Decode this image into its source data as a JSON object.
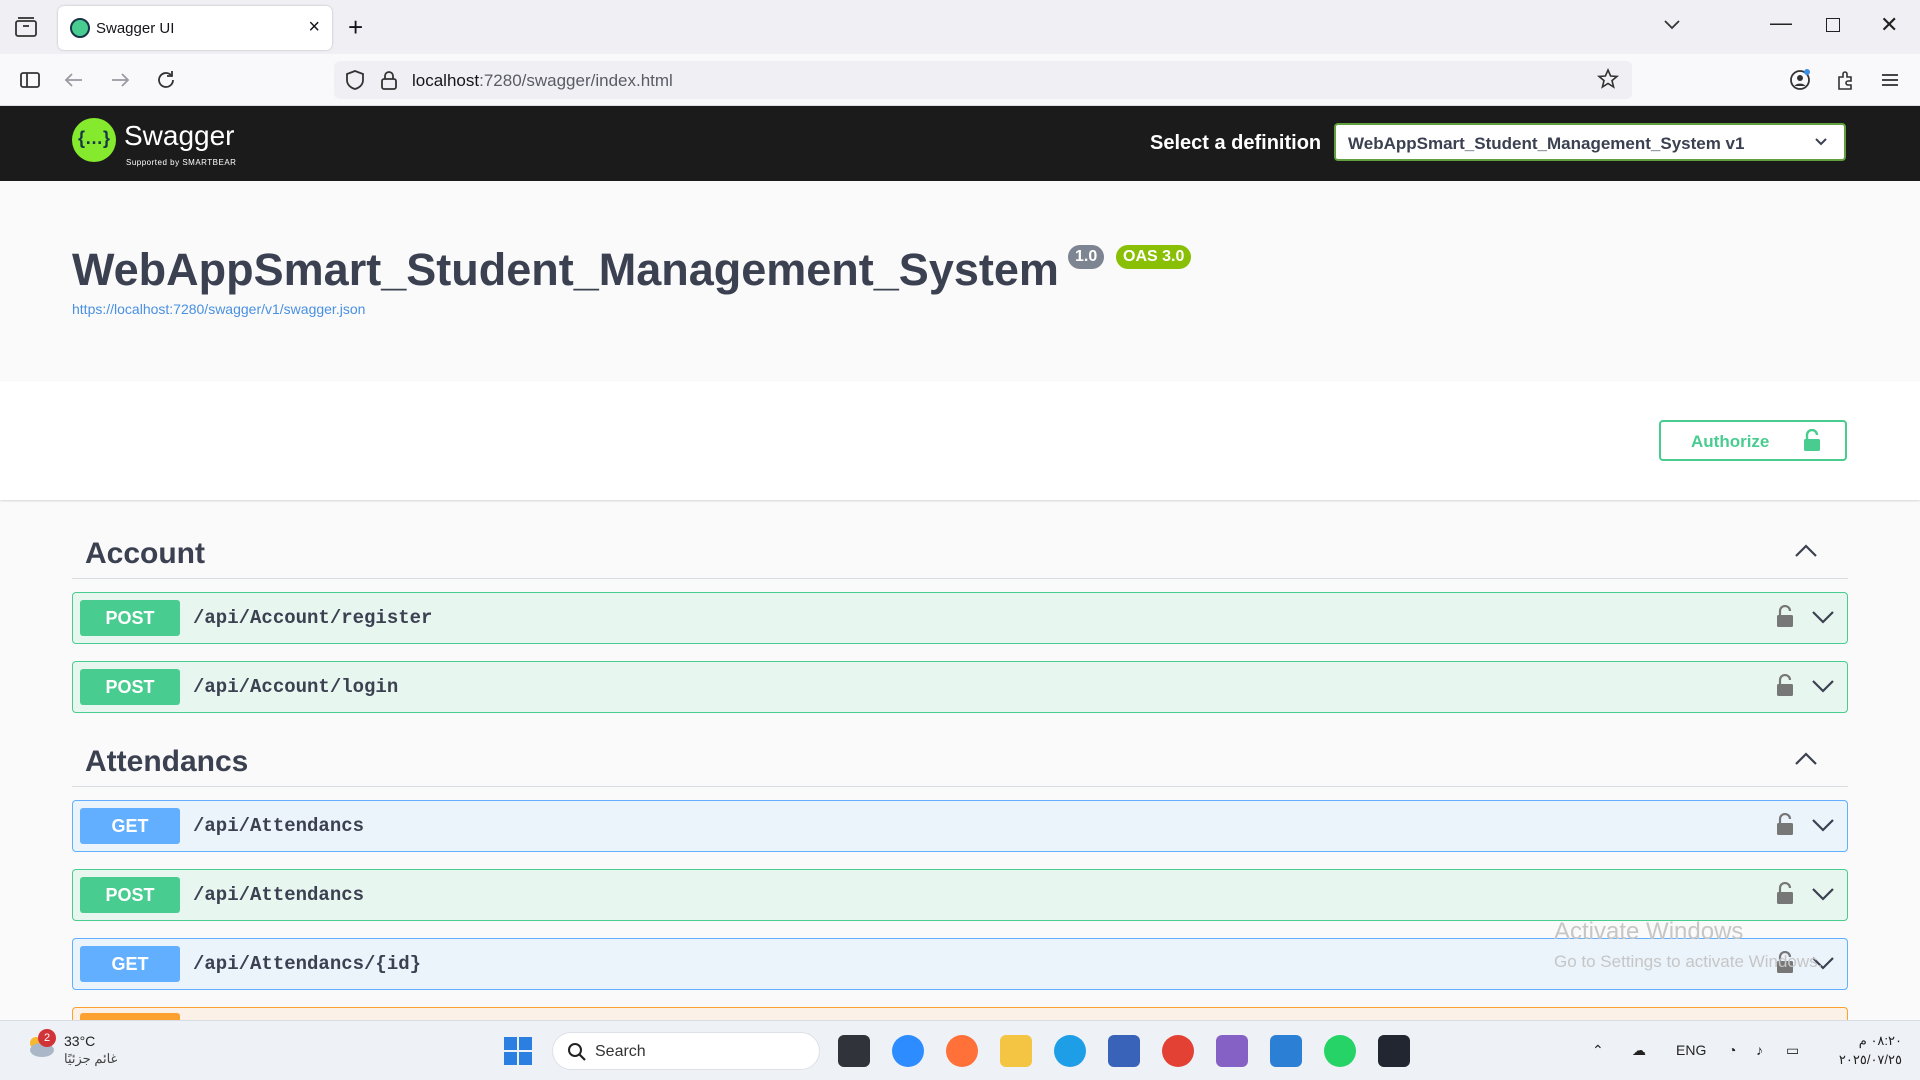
{
  "browser": {
    "tab": {
      "title": "Swagger UI",
      "close": "×"
    },
    "new_tab": "+",
    "url_host": "localhost",
    "url_rest": ":7280/swagger/index.html"
  },
  "swagger": {
    "logo_text": "Swagger",
    "logo_sub": "Supported by SMARTBEAR",
    "select_label": "Select a definition",
    "definition": "WebAppSmart_Student_Management_System v1"
  },
  "info": {
    "title": "WebAppSmart_Student_Management_System",
    "version": "1.0",
    "oas": "OAS 3.0",
    "spec_url": "https://localhost:7280/swagger/v1/swagger.json"
  },
  "authorize_label": "Authorize",
  "tags": [
    {
      "name": "Account",
      "operations": [
        {
          "method": "POST",
          "path": "/api/Account/register"
        },
        {
          "method": "POST",
          "path": "/api/Account/login"
        }
      ]
    },
    {
      "name": "Attendancs",
      "operations": [
        {
          "method": "GET",
          "path": "/api/Attendancs"
        },
        {
          "method": "POST",
          "path": "/api/Attendancs"
        },
        {
          "method": "GET",
          "path": "/api/Attendancs/{id}"
        }
      ]
    }
  ],
  "watermark": {
    "line1": "Activate Windows",
    "line2": "Go to Settings to activate Windows."
  },
  "taskbar": {
    "weather_badge": "2",
    "weather_temp": "33°C",
    "weather_desc": "غائم جزئيًا",
    "search_label": "Search",
    "language": "ENG",
    "time": "٠٨:٢٠ م",
    "date": "٢٠٢٥/٠٧/٢٥"
  },
  "colors": {
    "post": "#49cc90",
    "get": "#61affe",
    "put": "#fca130",
    "topbar": "#1b1b1b"
  }
}
